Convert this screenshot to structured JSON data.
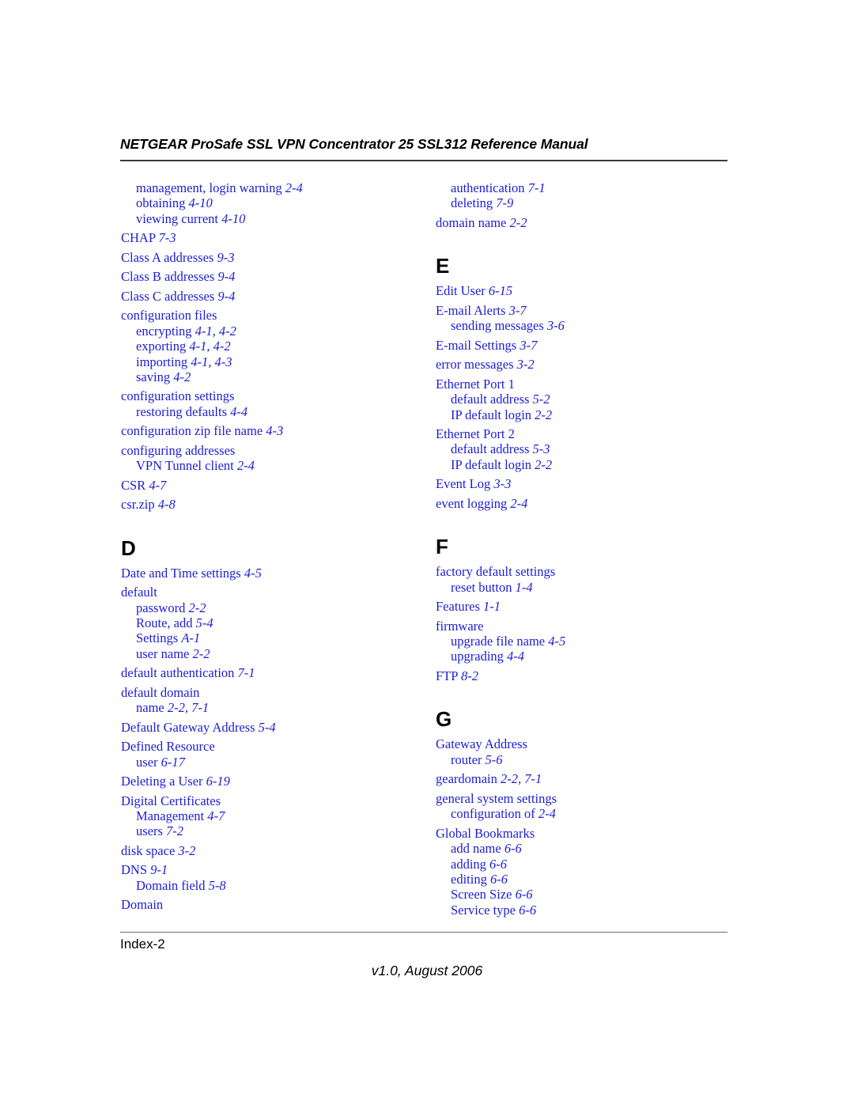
{
  "header": {
    "title": "NETGEAR ProSafe SSL VPN Concentrator 25 SSL312 Reference Manual"
  },
  "footer": {
    "folio": "Index-2",
    "version": "v1.0, August 2006"
  },
  "colors": {
    "entry_text": "#1d1dd4",
    "heading_text": "#000000",
    "rule": "#3b3b3b"
  },
  "index": {
    "left_column": [
      {
        "type": "entry",
        "level": 1,
        "text": "management, login warning ",
        "page": "2-4"
      },
      {
        "type": "entry",
        "level": 1,
        "text": "obtaining ",
        "page": "4-10"
      },
      {
        "type": "entry",
        "level": 1,
        "text": "viewing current ",
        "page": "4-10"
      },
      {
        "type": "entry",
        "level": 0,
        "text": "CHAP ",
        "page": "7-3"
      },
      {
        "type": "entry",
        "level": 0,
        "text": "Class A addresses ",
        "page": "9-3"
      },
      {
        "type": "entry",
        "level": 0,
        "text": "Class B addresses ",
        "page": "9-4"
      },
      {
        "type": "entry",
        "level": 0,
        "text": "Class C addresses ",
        "page": "9-4"
      },
      {
        "type": "entry",
        "level": 0,
        "text": "configuration files",
        "page": ""
      },
      {
        "type": "entry",
        "level": 1,
        "text": "encrypting ",
        "page": "4-1, 4-2"
      },
      {
        "type": "entry",
        "level": 1,
        "text": "exporting ",
        "page": "4-1, 4-2"
      },
      {
        "type": "entry",
        "level": 1,
        "text": "importing ",
        "page": "4-1, 4-3"
      },
      {
        "type": "entry",
        "level": 1,
        "text": "saving ",
        "page": "4-2"
      },
      {
        "type": "entry",
        "level": 0,
        "text": "configuration settings",
        "page": ""
      },
      {
        "type": "entry",
        "level": 1,
        "text": "restoring defaults ",
        "page": "4-4"
      },
      {
        "type": "entry",
        "level": 0,
        "text": "configuration zip file name ",
        "page": "4-3"
      },
      {
        "type": "entry",
        "level": 0,
        "text": "configuring addresses",
        "page": ""
      },
      {
        "type": "entry",
        "level": 1,
        "text": "VPN Tunnel client ",
        "page": "2-4"
      },
      {
        "type": "entry",
        "level": 0,
        "text": "CSR ",
        "page": "4-7"
      },
      {
        "type": "entry",
        "level": 0,
        "text": "csr.zip ",
        "page": "4-8"
      },
      {
        "type": "letter",
        "text": "D"
      },
      {
        "type": "entry",
        "level": 0,
        "text": "Date and Time settings ",
        "page": "4-5"
      },
      {
        "type": "entry",
        "level": 0,
        "text": "default",
        "page": ""
      },
      {
        "type": "entry",
        "level": 1,
        "text": "password ",
        "page": "2-2"
      },
      {
        "type": "entry",
        "level": 1,
        "text": "Route, add ",
        "page": "5-4"
      },
      {
        "type": "entry",
        "level": 1,
        "text": "Settings ",
        "page": "A-1"
      },
      {
        "type": "entry",
        "level": 1,
        "text": "user name ",
        "page": "2-2"
      },
      {
        "type": "entry",
        "level": 0,
        "text": "default authentication ",
        "page": "7-1"
      },
      {
        "type": "entry",
        "level": 0,
        "text": "default domain",
        "page": ""
      },
      {
        "type": "entry",
        "level": 1,
        "text": "name ",
        "page": "2-2, 7-1"
      },
      {
        "type": "entry",
        "level": 0,
        "text": "Default Gateway Address ",
        "page": "5-4"
      },
      {
        "type": "entry",
        "level": 0,
        "text": "Defined Resource",
        "page": ""
      },
      {
        "type": "entry",
        "level": 1,
        "text": "user ",
        "page": "6-17"
      },
      {
        "type": "entry",
        "level": 0,
        "text": "Deleting a User ",
        "page": "6-19"
      },
      {
        "type": "entry",
        "level": 0,
        "text": "Digital Certificates",
        "page": ""
      },
      {
        "type": "entry",
        "level": 1,
        "text": "Management ",
        "page": "4-7"
      },
      {
        "type": "entry",
        "level": 1,
        "text": "users ",
        "page": "7-2"
      },
      {
        "type": "entry",
        "level": 0,
        "text": "disk space ",
        "page": "3-2"
      },
      {
        "type": "entry",
        "level": 0,
        "text": "DNS ",
        "page": "9-1"
      },
      {
        "type": "entry",
        "level": 1,
        "text": "Domain field ",
        "page": "5-8"
      },
      {
        "type": "entry",
        "level": 0,
        "text": "Domain",
        "page": ""
      }
    ],
    "right_column": [
      {
        "type": "entry",
        "level": 1,
        "text": "authentication ",
        "page": "7-1"
      },
      {
        "type": "entry",
        "level": 1,
        "text": "deleting ",
        "page": "7-9"
      },
      {
        "type": "entry",
        "level": 0,
        "text": "domain name ",
        "page": "2-2"
      },
      {
        "type": "letter",
        "text": "E"
      },
      {
        "type": "entry",
        "level": 0,
        "text": "Edit User ",
        "page": "6-15"
      },
      {
        "type": "entry",
        "level": 0,
        "text": "E-mail Alerts ",
        "page": "3-7"
      },
      {
        "type": "entry",
        "level": 1,
        "text": "sending messages ",
        "page": "3-6"
      },
      {
        "type": "entry",
        "level": 0,
        "text": "E-mail Settings ",
        "page": "3-7"
      },
      {
        "type": "entry",
        "level": 0,
        "text": "error messages ",
        "page": "3-2"
      },
      {
        "type": "entry",
        "level": 0,
        "text": "Ethernet Port 1",
        "page": ""
      },
      {
        "type": "entry",
        "level": 1,
        "text": "default address ",
        "page": "5-2"
      },
      {
        "type": "entry",
        "level": 1,
        "text": "IP default login ",
        "page": "2-2"
      },
      {
        "type": "entry",
        "level": 0,
        "text": "Ethernet Port 2",
        "page": ""
      },
      {
        "type": "entry",
        "level": 1,
        "text": "default address ",
        "page": "5-3"
      },
      {
        "type": "entry",
        "level": 1,
        "text": "IP default login ",
        "page": "2-2"
      },
      {
        "type": "entry",
        "level": 0,
        "text": "Event Log ",
        "page": "3-3"
      },
      {
        "type": "entry",
        "level": 0,
        "text": "event logging ",
        "page": "2-4"
      },
      {
        "type": "letter",
        "text": "F"
      },
      {
        "type": "entry",
        "level": 0,
        "text": "factory default settings",
        "page": ""
      },
      {
        "type": "entry",
        "level": 1,
        "text": "reset button ",
        "page": "1-4"
      },
      {
        "type": "entry",
        "level": 0,
        "text": "Features ",
        "page": "1-1"
      },
      {
        "type": "entry",
        "level": 0,
        "text": "firmware",
        "page": ""
      },
      {
        "type": "entry",
        "level": 1,
        "text": "upgrade file name ",
        "page": "4-5"
      },
      {
        "type": "entry",
        "level": 1,
        "text": "upgrading ",
        "page": "4-4"
      },
      {
        "type": "entry",
        "level": 0,
        "text": "FTP ",
        "page": "8-2"
      },
      {
        "type": "letter",
        "text": "G"
      },
      {
        "type": "entry",
        "level": 0,
        "text": "Gateway Address",
        "page": ""
      },
      {
        "type": "entry",
        "level": 1,
        "text": "router ",
        "page": "5-6"
      },
      {
        "type": "entry",
        "level": 0,
        "text": "geardomain ",
        "page": "2-2, 7-1"
      },
      {
        "type": "entry",
        "level": 0,
        "text": "general system settings",
        "page": ""
      },
      {
        "type": "entry",
        "level": 1,
        "text": "configuration of ",
        "page": "2-4"
      },
      {
        "type": "entry",
        "level": 0,
        "text": "Global Bookmarks",
        "page": ""
      },
      {
        "type": "entry",
        "level": 1,
        "text": "add name ",
        "page": "6-6"
      },
      {
        "type": "entry",
        "level": 1,
        "text": "adding ",
        "page": "6-6"
      },
      {
        "type": "entry",
        "level": 1,
        "text": "editing ",
        "page": "6-6"
      },
      {
        "type": "entry",
        "level": 1,
        "text": "Screen Size ",
        "page": "6-6"
      },
      {
        "type": "entry",
        "level": 1,
        "text": "Service type ",
        "page": "6-6"
      }
    ]
  }
}
